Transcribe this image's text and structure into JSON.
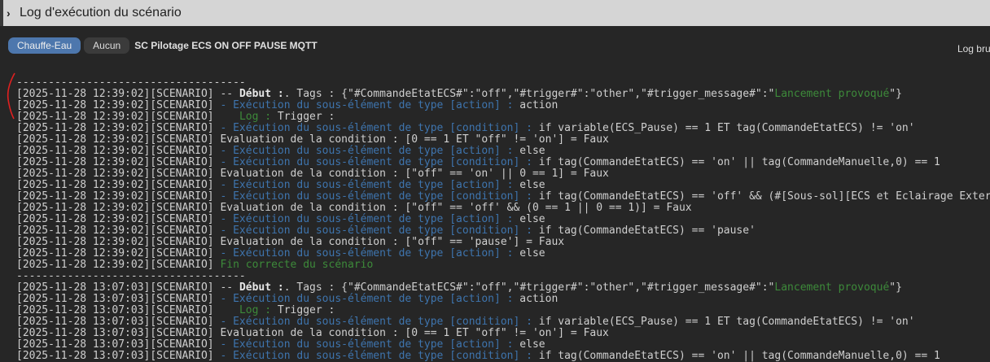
{
  "header": {
    "title": "Log d'exécution du scénario"
  },
  "toolbar": {
    "group_button": "Chauffe-Eau",
    "object_button": "Aucun",
    "scenario_name": "SC Pilotage ECS ON OFF PAUSE MQTT",
    "raw_log_link": "Log brut"
  },
  "colors": {
    "accent": "#4d77ad",
    "blue_text": "#3e74ad",
    "green_text": "#3d8a3a",
    "annotation": "#e02020"
  },
  "log_lines": [
    [
      [
        "",
        "------------------------------------"
      ]
    ],
    [
      [
        "",
        "[2025-11-28 12:39:02][SCENARIO] -- "
      ],
      [
        "bold",
        "Début :"
      ],
      [
        "",
        ". Tags : {\"#CommandeEtatECS#\":\"off\",\"#trigger#\":\"other\",\"#trigger_message#\":\""
      ],
      [
        "green",
        "Lancement provoqué"
      ],
      [
        "",
        "\"}"
      ]
    ],
    [
      [
        "",
        "[2025-11-28 12:39:02][SCENARIO] "
      ],
      [
        "blue",
        "- Exécution du sous-élément de type [action] :"
      ],
      [
        "",
        " action"
      ]
    ],
    [
      [
        "",
        "[2025-11-28 12:39:02][SCENARIO]    "
      ],
      [
        "green",
        "Log :"
      ],
      [
        "",
        " Trigger :"
      ]
    ],
    [
      [
        "",
        "[2025-11-28 12:39:02][SCENARIO] "
      ],
      [
        "blue",
        "- Exécution du sous-élément de type [condition] :"
      ],
      [
        "",
        " if variable(ECS_Pause) == 1 ET tag(CommandeEtatECS) != 'on'"
      ]
    ],
    [
      [
        "",
        "[2025-11-28 12:39:02][SCENARIO] Evaluation de la condition : [0 == 1 ET \"off\" != 'on'] = Faux"
      ]
    ],
    [
      [
        "",
        "[2025-11-28 12:39:02][SCENARIO] "
      ],
      [
        "blue",
        "- Exécution du sous-élément de type [action] :"
      ],
      [
        "",
        " else"
      ]
    ],
    [
      [
        "",
        "[2025-11-28 12:39:02][SCENARIO] "
      ],
      [
        "blue",
        "- Exécution du sous-élément de type [condition] :"
      ],
      [
        "",
        " if tag(CommandeEtatECS) == 'on' || tag(CommandeManuelle,0) == 1"
      ]
    ],
    [
      [
        "",
        "[2025-11-28 12:39:02][SCENARIO] Evaluation de la condition : [\"off\" == 'on' || 0 == 1] = Faux"
      ]
    ],
    [
      [
        "",
        "[2025-11-28 12:39:02][SCENARIO] "
      ],
      [
        "blue",
        "- Exécution du sous-élément de type [action] :"
      ],
      [
        "",
        " else"
      ]
    ],
    [
      [
        "",
        "[2025-11-28 12:39:02][SCENARIO] "
      ],
      [
        "blue",
        "- Exécution du sous-élément de type [condition] :"
      ],
      [
        "",
        " if tag(CommandeEtatECS) == 'off' && (#[Sous-sol][ECS et Eclairage Exter"
      ]
    ],
    [
      [
        "",
        "[2025-11-28 12:39:02][SCENARIO] Evaluation de la condition : [\"off\" == 'off' && (0 == 1 || 0 == 1)] = Faux"
      ]
    ],
    [
      [
        "",
        "[2025-11-28 12:39:02][SCENARIO] "
      ],
      [
        "blue",
        "- Exécution du sous-élément de type [action] :"
      ],
      [
        "",
        " else"
      ]
    ],
    [
      [
        "",
        "[2025-11-28 12:39:02][SCENARIO] "
      ],
      [
        "blue",
        "- Exécution du sous-élément de type [condition] :"
      ],
      [
        "",
        " if tag(CommandeEtatECS) == 'pause'"
      ]
    ],
    [
      [
        "",
        "[2025-11-28 12:39:02][SCENARIO] Evaluation de la condition : [\"off\" == 'pause'] = Faux"
      ]
    ],
    [
      [
        "",
        "[2025-11-28 12:39:02][SCENARIO] "
      ],
      [
        "blue",
        "- Exécution du sous-élément de type [action] :"
      ],
      [
        "",
        " else"
      ]
    ],
    [
      [
        "",
        "[2025-11-28 12:39:02][SCENARIO] "
      ],
      [
        "green",
        "Fin correcte du scénario"
      ]
    ],
    [
      [
        "",
        "------------------------------------"
      ]
    ],
    [
      [
        "",
        "[2025-11-28 13:07:03][SCENARIO] -- "
      ],
      [
        "bold",
        "Début :"
      ],
      [
        "",
        ". Tags : {\"#CommandeEtatECS#\":\"off\",\"#trigger#\":\"other\",\"#trigger_message#\":\""
      ],
      [
        "green",
        "Lancement provoqué"
      ],
      [
        "",
        "\"}"
      ]
    ],
    [
      [
        "",
        "[2025-11-28 13:07:03][SCENARIO] "
      ],
      [
        "blue",
        "- Exécution du sous-élément de type [action] :"
      ],
      [
        "",
        " action"
      ]
    ],
    [
      [
        "",
        "[2025-11-28 13:07:03][SCENARIO]    "
      ],
      [
        "green",
        "Log :"
      ],
      [
        "",
        " Trigger :"
      ]
    ],
    [
      [
        "",
        "[2025-11-28 13:07:03][SCENARIO] "
      ],
      [
        "blue",
        "- Exécution du sous-élément de type [condition] :"
      ],
      [
        "",
        " if variable(ECS_Pause) == 1 ET tag(CommandeEtatECS) != 'on'"
      ]
    ],
    [
      [
        "",
        "[2025-11-28 13:07:03][SCENARIO] Evaluation de la condition : [0 == 1 ET \"off\" != 'on'] = Faux"
      ]
    ],
    [
      [
        "",
        "[2025-11-28 13:07:03][SCENARIO] "
      ],
      [
        "blue",
        "- Exécution du sous-élément de type [action] :"
      ],
      [
        "",
        " else"
      ]
    ],
    [
      [
        "",
        "[2025-11-28 13:07:03][SCENARIO] "
      ],
      [
        "blue",
        "- Exécution du sous-élément de type [condition] :"
      ],
      [
        "",
        " if tag(CommandeEtatECS) == 'on' || tag(CommandeManuelle,0) == 1"
      ]
    ]
  ]
}
